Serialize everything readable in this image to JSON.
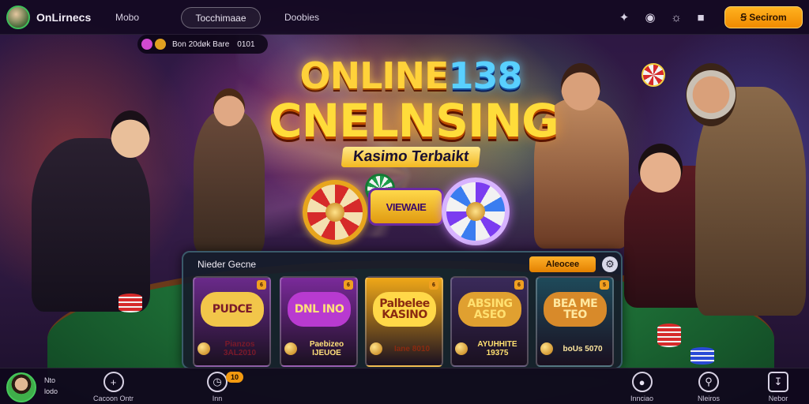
{
  "topbar": {
    "brand_name": "OnLirnecs",
    "nav": [
      "Mobo",
      "Tocchimaae",
      "Doobies"
    ],
    "active_nav_index": 1,
    "icons": [
      "puzzle-icon",
      "camera-icon",
      "globe-icon",
      "chat-icon"
    ],
    "search_label": "Ꞩ Secirom"
  },
  "ticker": {
    "text": "Bon 20døk Bare",
    "suffix": "0101"
  },
  "hero": {
    "line1_a": "ONLINE",
    "line1_b": "138",
    "line2": "CNELNSING",
    "subtitle": "Kasimo Terbaikt",
    "badge": "VIEWAIE"
  },
  "panel": {
    "title": "Nieder Gecne",
    "more_label": "Aleocee",
    "cards": [
      {
        "title": "PUDCE",
        "footer": "Pianzos 3AL2010",
        "tag": "6",
        "bg": "#6a2a8a",
        "plate": "#f2c64a",
        "text": "#7a1a2a"
      },
      {
        "title": "DNL INO",
        "footer": "Paebizeo IJEUOE",
        "tag": "6",
        "bg": "#7a2a9a",
        "plate": "#b83ad0",
        "text": "#ffe07a"
      },
      {
        "title": "Palbelee KASINO",
        "footer": "Iane 8010",
        "tag": "6",
        "bg": "#f0a818",
        "plate": "#ffd848",
        "text": "#8a2a10"
      },
      {
        "title": "ABSING ASEO",
        "footer": "AYUHHITE 19375",
        "tag": "6",
        "bg": "#3a2a5a",
        "plate": "#e0a030",
        "text": "#ffe070"
      },
      {
        "title": "BEA ME TEO",
        "footer": "boUs 5070",
        "tag": "5",
        "bg": "#1e4a5a",
        "plate": "#d88a2a",
        "text": "#ffe8a0"
      }
    ]
  },
  "bottombar": {
    "user_line1": "Nto",
    "user_line2": "lodo",
    "items": [
      {
        "label": "Cacoon Ontr",
        "icon": "plus-icon"
      },
      {
        "label": "Inn",
        "icon": "clock-icon",
        "badge": "10"
      },
      {
        "label": "Innciao",
        "icon": "location-icon"
      },
      {
        "label": "Nleiros",
        "icon": "search-icon"
      },
      {
        "label": "Nebor",
        "icon": "download-icon"
      }
    ]
  },
  "colors": {
    "accent": "#f39a10",
    "brand_green": "#46c85a",
    "bar_bg": "#140a22"
  }
}
